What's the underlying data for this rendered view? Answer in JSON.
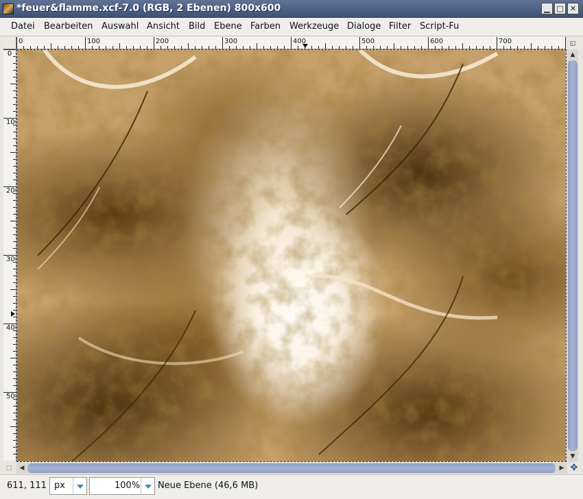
{
  "window": {
    "title": "*feuer&flamme.xcf-7.0 (RGB, 2 Ebenen) 800x600",
    "min_glyph": "▁",
    "max_glyph": "□",
    "close_glyph": "✕"
  },
  "menu": [
    "Datei",
    "Bearbeiten",
    "Auswahl",
    "Ansicht",
    "Bild",
    "Ebene",
    "Farben",
    "Werkzeuge",
    "Dialoge",
    "Filter",
    "Script-Fu"
  ],
  "rulers": {
    "horizontal": [
      "0",
      "100",
      "200",
      "300",
      "400",
      "500",
      "600",
      "700"
    ],
    "vertical": [
      "0",
      "100",
      "200",
      "300",
      "400",
      "500"
    ]
  },
  "statusbar": {
    "coords": "611, 111",
    "unit": "px",
    "zoom": "100%",
    "message": "Neue Ebene (46,6 MB)"
  },
  "colors": {
    "titlebar": "#4e6387",
    "scroll_thumb": "#9aa8cd",
    "canvas_dark": "#5a3a0e",
    "canvas_light": "#fdf8ef"
  }
}
